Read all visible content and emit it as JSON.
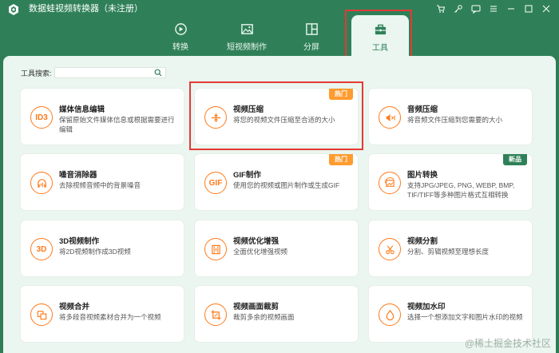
{
  "app": {
    "title": "数据蛙视频转换器（未注册）"
  },
  "nav": {
    "tabs": [
      {
        "label": "转换"
      },
      {
        "label": "短视频制作"
      },
      {
        "label": "分屏"
      },
      {
        "label": "工具"
      }
    ]
  },
  "search": {
    "label": "工具搜索:",
    "value": "",
    "placeholder": ""
  },
  "tools": [
    {
      "title": "媒体信息编辑",
      "desc": "保留原始文件媒体信息或根据需要进行编辑",
      "icon_text": "ID3",
      "badge": ""
    },
    {
      "title": "视频压缩",
      "desc": "将您的视频文件压缩至合适的大小",
      "icon_text": "",
      "badge": "热门"
    },
    {
      "title": "音频压缩",
      "desc": "将音频文件压缩到您需要的大小",
      "icon_text": "",
      "badge": ""
    },
    {
      "title": "噪音消除器",
      "desc": "去除视频音频中的背景噪音",
      "icon_text": "",
      "badge": ""
    },
    {
      "title": "GIF制作",
      "desc": "使用您的视频或图片制作或生成GIF",
      "icon_text": "GIF",
      "badge": "热门"
    },
    {
      "title": "图片转换",
      "desc": "支持JPG/JPEG, PNG, WEBP, BMP, TIF/TIFF等多种图片格式互相转换",
      "icon_text": "",
      "badge": "新品"
    },
    {
      "title": "3D视频制作",
      "desc": "将2D视频制作成3D视频",
      "icon_text": "3D",
      "badge": ""
    },
    {
      "title": "视频优化增强",
      "desc": "全面优化增强视频",
      "icon_text": "",
      "badge": ""
    },
    {
      "title": "视频分割",
      "desc": "分割、剪辑视频至理想长度",
      "icon_text": "",
      "badge": ""
    },
    {
      "title": "视频合并",
      "desc": "将多段音视频素材合并为一个视频",
      "icon_text": "",
      "badge": ""
    },
    {
      "title": "视频画面裁剪",
      "desc": "裁剪多余的视频画面",
      "icon_text": "",
      "badge": ""
    },
    {
      "title": "视频加水印",
      "desc": "选择一个想添加文字和图片水印的视频",
      "icon_text": "",
      "badge": ""
    }
  ],
  "watermark": "@稀土掘金技术社区",
  "colors": {
    "primary": "#2f8058",
    "accent": "#ff7a1a",
    "hot": "#ff9b2f",
    "highlight": "#e53935"
  }
}
